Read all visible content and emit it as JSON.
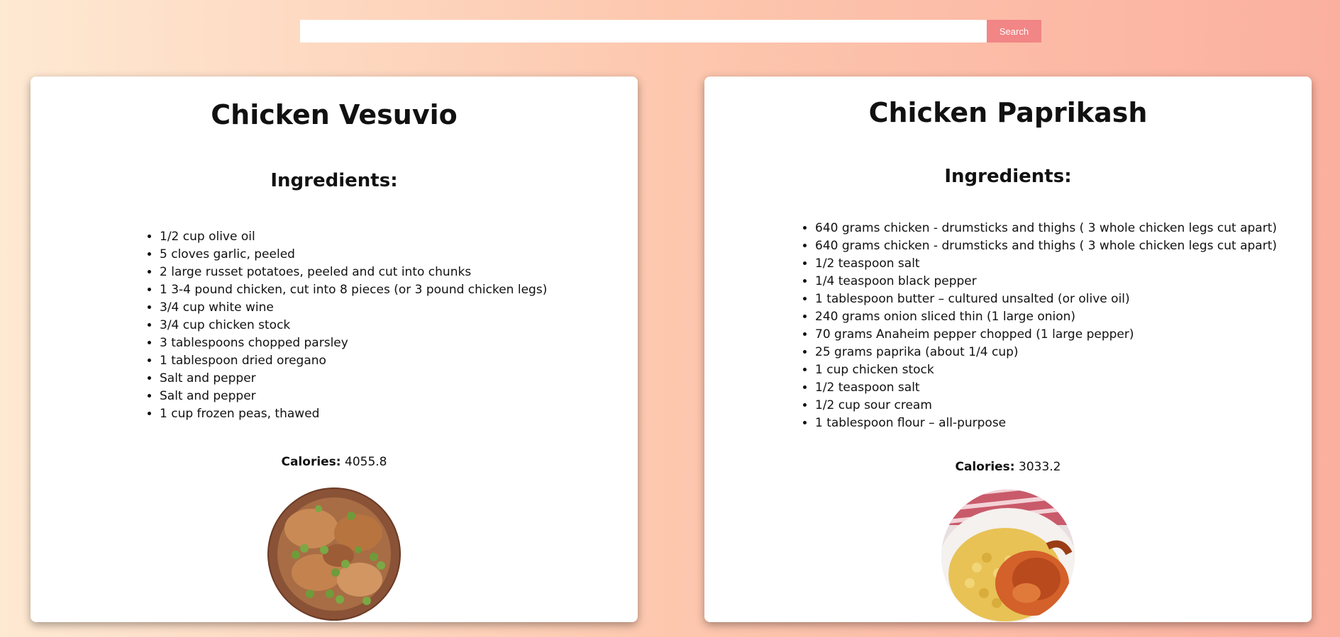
{
  "search": {
    "value": "",
    "placeholder": "",
    "button_label": "Search"
  },
  "recipes": [
    {
      "title": "Chicken Vesuvio",
      "ingredients_heading": "Ingredients:",
      "ingredients": [
        "1/2 cup olive oil",
        "5 cloves garlic, peeled",
        "2 large russet potatoes, peeled and cut into chunks",
        "1 3-4 pound chicken, cut into 8 pieces (or 3 pound chicken legs)",
        "3/4 cup white wine",
        "3/4 cup chicken stock",
        "3 tablespoons chopped parsley",
        "1 tablespoon dried oregano",
        "Salt and pepper",
        "Salt and pepper",
        "1 cup frozen peas, thawed"
      ],
      "calories_label": "Calories:",
      "calories_value": "4055.8",
      "image_icon": "chicken-vesuvio-photo"
    },
    {
      "title": "Chicken Paprikash",
      "ingredients_heading": "Ingredients:",
      "ingredients": [
        "640 grams chicken - drumsticks and thighs ( 3 whole chicken legs cut apart)",
        "640 grams chicken - drumsticks and thighs ( 3 whole chicken legs cut apart)",
        "1/2 teaspoon salt",
        "1/4 teaspoon black pepper",
        "1 tablespoon butter – cultured unsalted (or olive oil)",
        "240 grams onion sliced thin (1 large onion)",
        "70 grams Anaheim pepper chopped (1 large pepper)",
        "25 grams paprika (about 1/4 cup)",
        "1 cup chicken stock",
        "1/2 teaspoon salt",
        "1/2 cup sour cream",
        "1 tablespoon flour – all-purpose"
      ],
      "calories_label": "Calories:",
      "calories_value": "3033.2",
      "image_icon": "chicken-paprikash-photo"
    }
  ],
  "colors": {
    "background_start": "#fee9d3",
    "background_end": "#fbb09f",
    "search_button": "#f28585",
    "card": "#ffffff"
  }
}
